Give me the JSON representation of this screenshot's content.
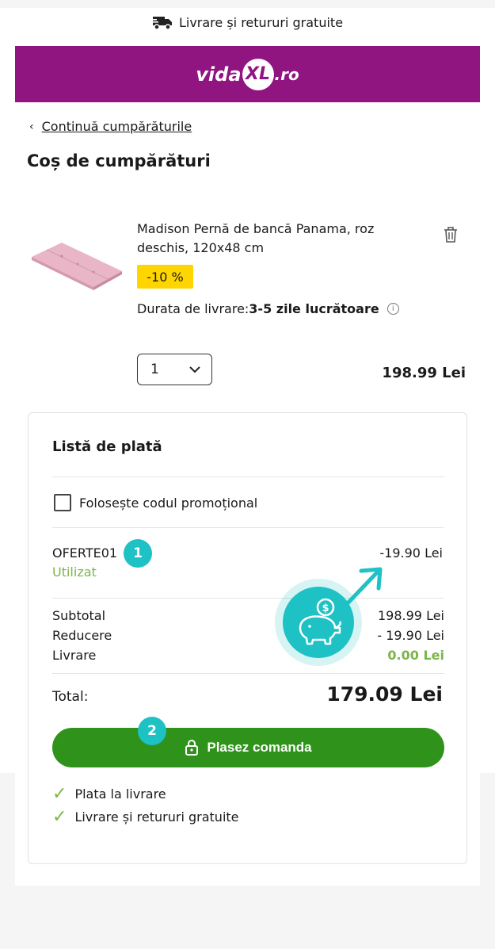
{
  "topbar": {
    "shipping_text": "Livrare și retururi gratuite",
    "icon": "delivery-truck-icon"
  },
  "header": {
    "logo_main": "vida",
    "logo_xl": "XL",
    "logo_tld": ".ro",
    "brand_color": "#911580"
  },
  "nav": {
    "back_label": "Continuă cumpărăturile"
  },
  "page": {
    "title": "Coș de cumpărături"
  },
  "product": {
    "name": "Madison Pernă de bancă Panama, roz deschis, 120x48 cm",
    "discount_badge": "-10 %",
    "delivery_label": "Durata de livrare:",
    "delivery_value": "3-5 zile lucrătoare",
    "quantity": "1",
    "price": "198.99 Lei"
  },
  "summary": {
    "title": "Listă de plată",
    "promo_checkbox_label": "Folosește codul promoțional",
    "promo_code": "OFERTE01",
    "promo_status": "Utilizat",
    "promo_value": "-19.90 Lei",
    "subtotal_label": "Subtotal",
    "subtotal_value": "198.99 Lei",
    "discount_label": "Reducere",
    "discount_value": "- 19.90 Lei",
    "shipping_label": "Livrare",
    "shipping_value": "0.00 Lei",
    "total_label": "Total:",
    "total_value": "179.09 Lei",
    "order_button": "Plasez comanda",
    "features": [
      "Plata la livrare",
      "Livrare și retururi gratuite"
    ]
  },
  "annotations": {
    "step1": "1",
    "step2": "2",
    "accent_color": "#1ec1c4"
  },
  "colors": {
    "button_green": "#2f921a",
    "badge_yellow": "#ffd500",
    "success_green": "#7ab648"
  }
}
